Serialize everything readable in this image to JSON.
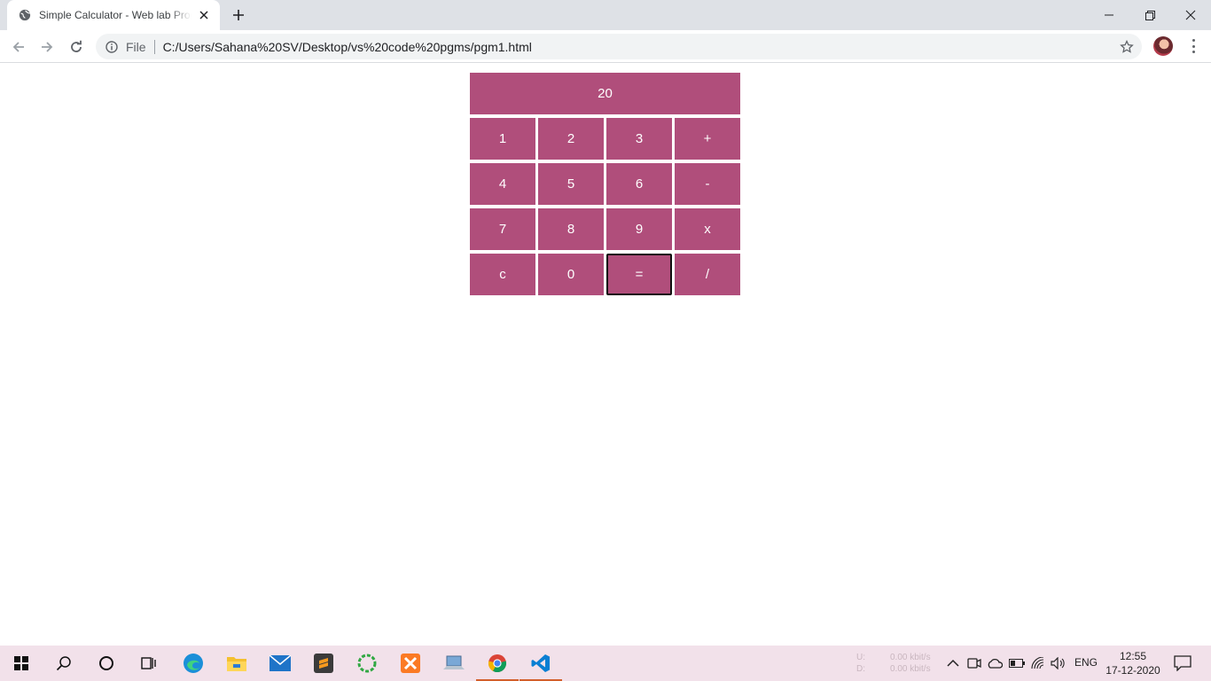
{
  "browser": {
    "tab_title": "Simple Calculator - Web lab Prog",
    "omnibox_scheme": "File",
    "url": "C:/Users/Sahana%20SV/Desktop/vs%20code%20pgms/pgm1.html"
  },
  "calculator": {
    "display": "20",
    "keys": [
      "1",
      "2",
      "3",
      "+",
      "4",
      "5",
      "6",
      "-",
      "7",
      "8",
      "9",
      "x",
      "c",
      "0",
      "=",
      "/"
    ],
    "focused_key": "=",
    "button_color": "#b04e7b"
  },
  "taskbar": {
    "net_upload_label": "U:",
    "net_download_label": "D:",
    "net_upload": "0.00 kbit/s",
    "net_download": "0.00 kbit/s",
    "language": "ENG",
    "time": "12:55",
    "date": "17-12-2020",
    "pinned": [
      "start-icon",
      "search-icon",
      "cortana-icon",
      "task-view-icon",
      "edge-icon",
      "file-explorer-icon",
      "mail-icon",
      "sublime-text-icon",
      "green-app-icon",
      "xampp-icon",
      "laptop-app-icon",
      "chrome-icon",
      "vscode-icon"
    ]
  }
}
